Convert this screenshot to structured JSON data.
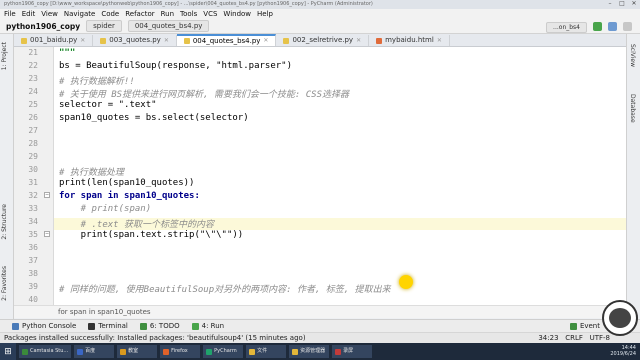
{
  "window": {
    "title": "python1906_copy [D:\\www_workspace\\pythonweb\\python1906_copy] - ...\\spider\\004_quotes_bs4.py [python1906_copy] - PyCharm (Administrator)"
  },
  "menu": [
    "File",
    "Edit",
    "View",
    "Navigate",
    "Code",
    "Refactor",
    "Run",
    "Tools",
    "VCS",
    "Window",
    "Help"
  ],
  "toolbar": {
    "project": "python1906_copy",
    "breadcrumb_file": "spider",
    "breadcrumb_current": "004_quotes_bs4.py",
    "run_config": "...on_bs4"
  },
  "tabs": [
    {
      "label": "001_baidu.py",
      "type": "py",
      "active": false
    },
    {
      "label": "003_quotes.py",
      "type": "py",
      "active": false
    },
    {
      "label": "004_quotes_bs4.py",
      "type": "py",
      "active": true
    },
    {
      "label": "002_selretrive.py",
      "type": "py",
      "active": false
    },
    {
      "label": "mybaidu.html",
      "type": "html",
      "active": false
    }
  ],
  "left_tools": [
    "1: Project",
    "2: Structure",
    "2: Favorites"
  ],
  "right_tools": [
    "SciView",
    "Database"
  ],
  "code_lines": [
    {
      "n": "21",
      "html": "",
      "text": "\"\"\""
    },
    {
      "n": "22",
      "text": "bs = BeautifulSoup(response, \"html.parser\")"
    },
    {
      "n": "23",
      "text": "# 执行数据解析!!"
    },
    {
      "n": "24",
      "text": "# 关于使用 BS提供来进行网页解析, 需要我们会一个技能: CSS选择器"
    },
    {
      "n": "25",
      "text": "selector = \".text\""
    },
    {
      "n": "26",
      "text": "span10_quotes = bs.select(selector)"
    },
    {
      "n": "27",
      "text": ""
    },
    {
      "n": "28",
      "text": ""
    },
    {
      "n": "29",
      "text": ""
    },
    {
      "n": "30",
      "text": "# 执行数据处理"
    },
    {
      "n": "31",
      "text": "print(len(span10_quotes))"
    },
    {
      "n": "32",
      "text": "for span in span10_quotes:"
    },
    {
      "n": "33",
      "text": "    # print(span)"
    },
    {
      "n": "34",
      "text": "    # .text 获取一个标签中的内容"
    },
    {
      "n": "35",
      "text": "    print(span.text.strip(\"\\\"\\\"\"))"
    },
    {
      "n": "36",
      "text": ""
    },
    {
      "n": "37",
      "text": ""
    },
    {
      "n": "38",
      "text": ""
    },
    {
      "n": "39",
      "text": "# 同样的问题, 使用BeautifulSoup对另外的两项内容: 作者, 标签, 提取出来"
    },
    {
      "n": "40",
      "text": ""
    }
  ],
  "breadcrumb_bottom": "for span in span10_quotes",
  "tool_windows": [
    {
      "label": "Python Console",
      "color": "#4a7ab8"
    },
    {
      "label": "Terminal",
      "color": "#333333"
    },
    {
      "label": "6: TODO",
      "color": "#3f8f3f"
    },
    {
      "label": "4: Run",
      "color": "#49a54b"
    }
  ],
  "status": {
    "message": "Packages installed successfully: Installed packages: 'beautifulsoup4' (15 minutes ago)",
    "position": "34:23",
    "crlf": "CRLF",
    "encoding": "UTF-8",
    "event_log": "Event"
  },
  "taskbar": {
    "items": [
      {
        "label": "Camtasia Stu...",
        "color": "#3b8a3b"
      },
      {
        "label": "百度",
        "color": "#3a66c4"
      },
      {
        "label": "教室",
        "color": "#d99a1f"
      },
      {
        "label": "Firefox",
        "color": "#e0622a"
      },
      {
        "label": "PyCharm",
        "color": "#20a36b"
      },
      {
        "label": "文件",
        "color": "#e3b73a"
      },
      {
        "label": "资源管理器",
        "color": "#e3b73a"
      },
      {
        "label": "录屏",
        "color": "#c23b3b"
      }
    ],
    "clock": "14:44",
    "date": "2019/6/24"
  }
}
